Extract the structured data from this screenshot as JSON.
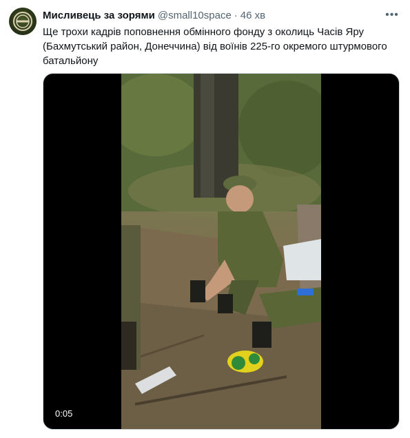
{
  "tweet": {
    "author_name": "Мисливець за зорями",
    "handle": "@small10space",
    "separator": "·",
    "time": "46 хв",
    "more_icon": "more-horizontal-icon",
    "text": "Ще трохи кадрів поповнення обмінного фонду з околиць Часів Яру (Бахмутський район, Донеччина) від воїнів 225-го окремого штурмового батальйону"
  },
  "video": {
    "duration": "0:05"
  },
  "colors": {
    "text_primary": "#0f1419",
    "text_secondary": "#536471",
    "border": "#cfd9de"
  }
}
